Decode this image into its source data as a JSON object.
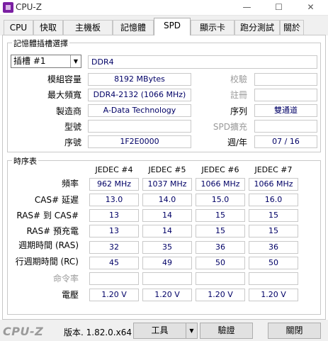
{
  "window": {
    "title": "CPU-Z",
    "minimize": "—",
    "maximize": "☐",
    "close": "✕"
  },
  "tabs": [
    "CPU",
    "快取",
    "主機板",
    "記憶體",
    "SPD",
    "顯示卡",
    "跑分測試",
    "關於"
  ],
  "active_tab": "SPD",
  "slot_group": {
    "title": "記憶體插槽選擇",
    "slot_value": "插槽 #1",
    "memory_type": "DDR4",
    "labels": {
      "module_size": "模組容量",
      "max_bandwidth": "最大頻寬",
      "manufacturer": "製造商",
      "part_number": "型號",
      "serial_number": "序號",
      "correction": "校驗",
      "registered": "註冊",
      "ranks": "序列",
      "spd_ext": "SPD擴充",
      "week_year": "週/年"
    },
    "values": {
      "module_size": "8192 MBytes",
      "max_bandwidth": "DDR4-2132 (1066 MHz)",
      "manufacturer": "A-Data Technology",
      "part_number": "",
      "serial_number": "1F2E0000",
      "correction": "",
      "registered": "",
      "ranks": "雙通道",
      "spd_ext": "",
      "week_year": "07 / 16"
    }
  },
  "timings_group": {
    "title": "時序表",
    "columns": [
      "JEDEC #4",
      "JEDEC #5",
      "JEDEC #6",
      "JEDEC #7"
    ],
    "rows": [
      {
        "label": "頻率",
        "values": [
          "962 MHz",
          "1037 MHz",
          "1066 MHz",
          "1066 MHz"
        ]
      },
      {
        "label": "CAS# 延遲",
        "values": [
          "13.0",
          "14.0",
          "15.0",
          "16.0"
        ]
      },
      {
        "label": "RAS# 到 CAS#",
        "values": [
          "13",
          "14",
          "15",
          "15"
        ]
      },
      {
        "label": "RAS# 預充電",
        "values": [
          "13",
          "14",
          "15",
          "15"
        ]
      },
      {
        "label": "週期時間 (RAS)",
        "values": [
          "32",
          "35",
          "36",
          "36"
        ]
      },
      {
        "label": "行週期時間 (RC)",
        "values": [
          "45",
          "49",
          "50",
          "50"
        ]
      },
      {
        "label": "命令率",
        "values": [
          "",
          "",
          "",
          ""
        ]
      },
      {
        "label": "電壓",
        "values": [
          "1.20 V",
          "1.20 V",
          "1.20 V",
          "1.20 V"
        ]
      }
    ]
  },
  "bottom": {
    "logo": "CPU-Z",
    "version": "版本. 1.82.0.x64",
    "tools_button": "工具",
    "tools_arrow": "▼",
    "validate_button": "驗證",
    "close_button": "關閉"
  }
}
